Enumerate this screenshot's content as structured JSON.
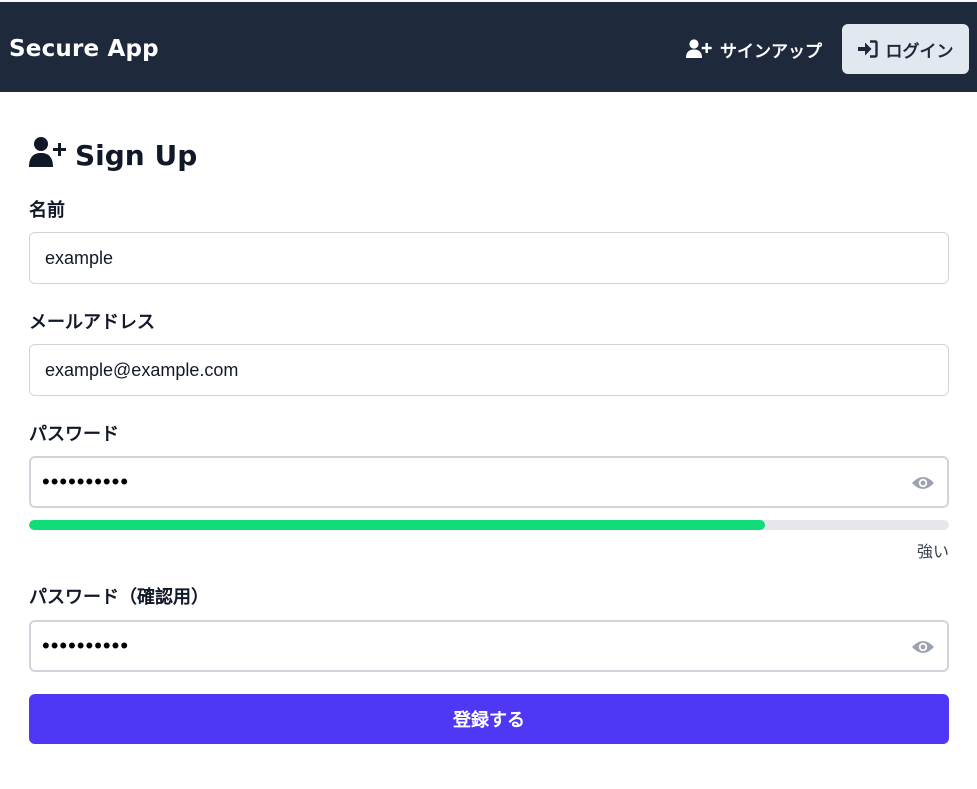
{
  "header": {
    "brand": "Secure App",
    "signup_label": "サインアップ",
    "login_label": "ログイン"
  },
  "form": {
    "title": "Sign Up",
    "name_label": "名前",
    "name_value": "example",
    "email_label": "メールアドレス",
    "email_value": "example@example.com",
    "password_label": "パスワード",
    "password_value": "••••••••••",
    "password_strength": 0.8,
    "password_strength_label": "強い",
    "confirm_label": "パスワード（確認用）",
    "confirm_value": "••••••••••",
    "submit_label": "登録する"
  },
  "colors": {
    "header_bg": "#1e293b",
    "accent": "#4f38f5",
    "strength_good": "#10dc78"
  },
  "icons": {
    "signup": "user-plus-icon",
    "login": "sign-in-icon",
    "title": "user-plus-icon",
    "toggle_password": "eye-icon"
  }
}
